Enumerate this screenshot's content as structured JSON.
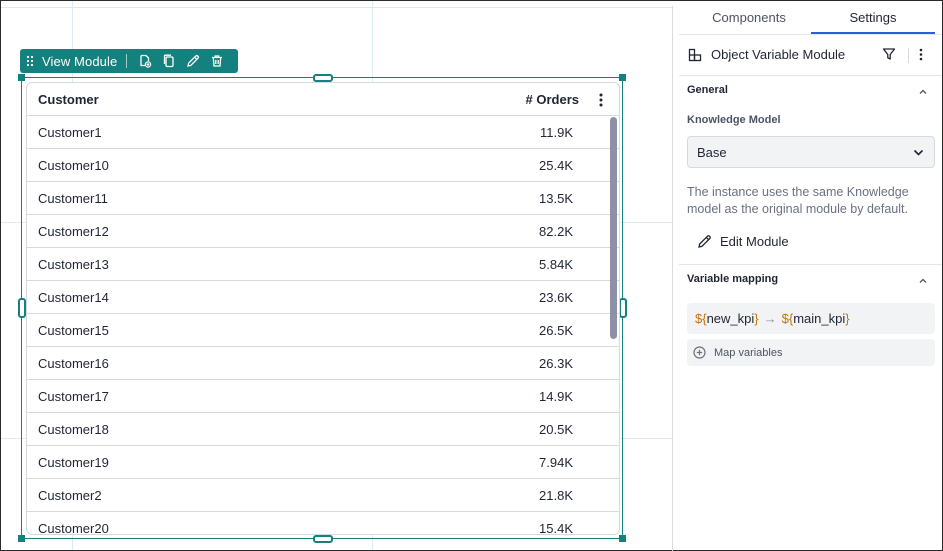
{
  "toolbar": {
    "label": "View Module"
  },
  "table": {
    "headers": {
      "customer": "Customer",
      "orders": "# Orders"
    },
    "rows": [
      {
        "customer": "Customer1",
        "orders": "11.9K"
      },
      {
        "customer": "Customer10",
        "orders": "25.4K"
      },
      {
        "customer": "Customer11",
        "orders": "13.5K"
      },
      {
        "customer": "Customer12",
        "orders": "82.2K"
      },
      {
        "customer": "Customer13",
        "orders": "5.84K"
      },
      {
        "customer": "Customer14",
        "orders": "23.6K"
      },
      {
        "customer": "Customer15",
        "orders": "26.5K"
      },
      {
        "customer": "Customer16",
        "orders": "26.3K"
      },
      {
        "customer": "Customer17",
        "orders": "14.9K"
      },
      {
        "customer": "Customer18",
        "orders": "20.5K"
      },
      {
        "customer": "Customer19",
        "orders": "7.94K"
      },
      {
        "customer": "Customer2",
        "orders": "21.8K"
      },
      {
        "customer": "Customer20",
        "orders": "15.4K"
      }
    ]
  },
  "panel": {
    "tabs": {
      "components": "Components",
      "settings": "Settings"
    },
    "object_title": "Object Variable Module",
    "general": {
      "title": "General",
      "knowledge_model_label": "Knowledge Model",
      "knowledge_model_value": "Base",
      "help_text": "The instance uses the same Knowledge model as the original module by default.",
      "edit_label": "Edit Module"
    },
    "variable_mapping": {
      "title": "Variable mapping",
      "source_prefix": "${",
      "source_name": "new_kpi",
      "source_suffix": "}",
      "arrow": "→",
      "target_prefix": "${",
      "target_name": "main_kpi",
      "target_suffix": "}",
      "map_label": "Map variables"
    }
  },
  "colors": {
    "accent": "#15817f",
    "tab_underline": "#2f5fd8",
    "token": "#c8730a"
  }
}
